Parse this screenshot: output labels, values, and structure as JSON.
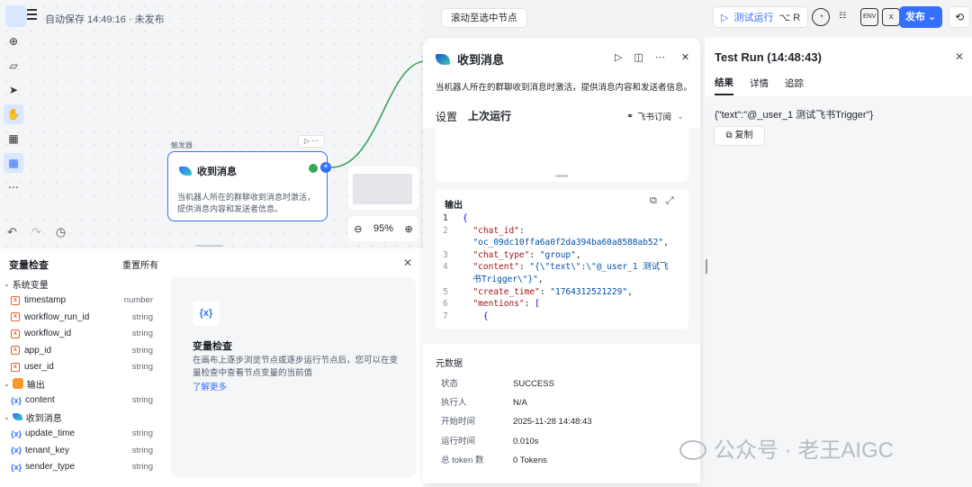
{
  "topbar": {
    "autosave": "自动保存 14:49:16 · 未发布",
    "scroll_to_node": "滚动至选中节点",
    "test_run": "测试运行",
    "test_run_shortcut": "⌥ R",
    "env_label": "ENV",
    "publish": "发布"
  },
  "canvas": {
    "node_group_label": "触发器",
    "node_title": "收到消息",
    "node_desc": "当机器人所在的群聊收到消息时激活，提供消息内容和发送者信息。",
    "zoom": "95%"
  },
  "variables": {
    "title": "变量检查",
    "reset_all": "重置所有",
    "groups": [
      {
        "label": "系统变量",
        "items": [
          {
            "name": "timestamp",
            "type": "number"
          },
          {
            "name": "workflow_run_id",
            "type": "string"
          },
          {
            "name": "workflow_id",
            "type": "string"
          },
          {
            "name": "app_id",
            "type": "string"
          },
          {
            "name": "user_id",
            "type": "string"
          }
        ]
      },
      {
        "label": "输出",
        "items": [
          {
            "name": "content",
            "type": "string"
          }
        ]
      },
      {
        "label": "收到消息",
        "items": [
          {
            "name": "update_time",
            "type": "string"
          },
          {
            "name": "tenant_key",
            "type": "string"
          },
          {
            "name": "sender_type",
            "type": "string"
          }
        ]
      }
    ],
    "inspect_icon": "{x}",
    "inspect_title": "变量检查",
    "inspect_desc": "在画布上逐步浏览节点或逐步运行节点后，您可以在变量检查中查看节点变量的当前值",
    "learn_more": "了解更多"
  },
  "detail": {
    "title": "收到消息",
    "desc": "当机器人所在的群聊收到消息时激活，提供消息内容和发送者信息。",
    "tab_settings": "设置",
    "tab_last_run": "上次运行",
    "subscription": "飞书订阅",
    "output_title": "输出",
    "code": {
      "l1": "{",
      "l2a": "\"chat_id\"",
      "l2b": "\"oc_09dc10ffa6a0f2da394ba60a8588ab52\"",
      "l3a": "\"chat_type\"",
      "l3b": "\"group\"",
      "l4a": "\"content\"",
      "l4b": "\"{\\\"text\\\":\\\"@_user_1 测试飞",
      "l4c": "书Trigger\\\"}\"",
      "l5a": "\"create_time\"",
      "l5b": "\"1764312521229\"",
      "l6a": "\"mentions\"",
      "l6b": "[",
      "l7": "{"
    },
    "meta_title": "元数据",
    "meta": [
      {
        "label": "状态",
        "value": "SUCCESS"
      },
      {
        "label": "执行人",
        "value": "N/A"
      },
      {
        "label": "开始时间",
        "value": "2025-11-28 14:48:43"
      },
      {
        "label": "运行时间",
        "value": "0.010s"
      },
      {
        "label": "总 token 数",
        "value": "0 Tokens"
      }
    ]
  },
  "testrun": {
    "title": "Test Run (14:48:43)",
    "tab_result": "结果",
    "tab_detail": "详情",
    "tab_trace": "追踪",
    "result": "{\"text\":\"@_user_1 测试飞书Trigger\"}",
    "copy": "复制"
  },
  "watermark": "公众号 · 老王AIGC"
}
